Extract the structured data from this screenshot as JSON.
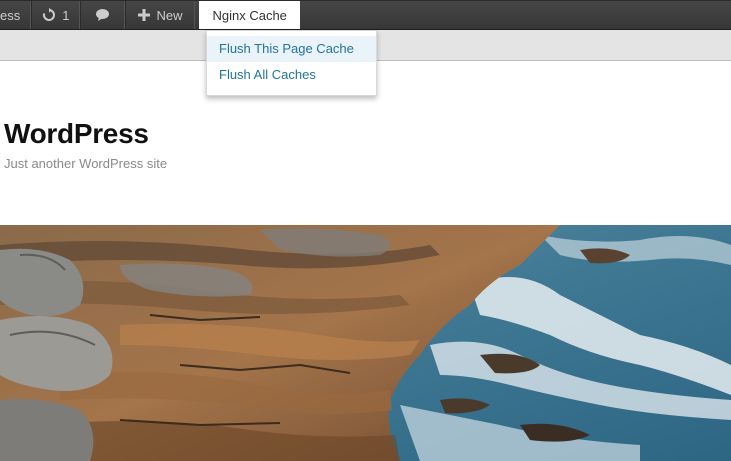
{
  "adminbar": {
    "site_name_partial": "ess",
    "updates_count": "1",
    "new_label": "New",
    "nginx_menu_label": "Nginx Cache",
    "icons": {
      "updates": "refresh-icon",
      "comments": "comment-bubble-icon",
      "new": "plus-icon"
    }
  },
  "nginx_dropdown": {
    "items": [
      {
        "label": "Flush This Page Cache"
      },
      {
        "label": "Flush All Caches"
      }
    ]
  },
  "site": {
    "title": "WordPress",
    "description": "Just another WordPress site"
  },
  "colors": {
    "adminbar_bg": "#3c3c3c",
    "link": "#21759b",
    "hover_bg": "#eaf2fa"
  }
}
